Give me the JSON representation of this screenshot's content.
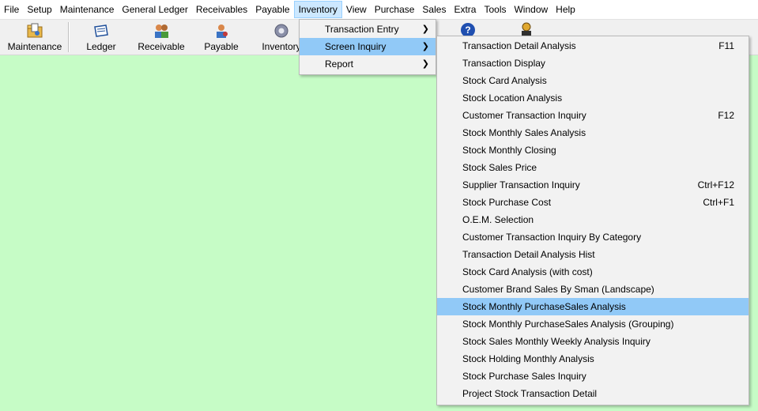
{
  "menubar": {
    "items": [
      "File",
      "Setup",
      "Maintenance",
      "General Ledger",
      "Receivables",
      "Payable",
      "Inventory",
      "View",
      "Purchase",
      "Sales",
      "Extra",
      "Tools",
      "Window",
      "Help"
    ],
    "active_index": 6
  },
  "toolbar": {
    "buttons": [
      {
        "label": "Maintenance",
        "icon": "folder-icon"
      },
      {
        "label": "Ledger",
        "icon": "ledger-icon"
      },
      {
        "label": "Receivable",
        "icon": "people-icon"
      },
      {
        "label": "Payable",
        "icon": "payable-icon"
      },
      {
        "label": "Inventory",
        "icon": "gear-icon"
      }
    ],
    "right_icons": [
      "help-icon",
      "user-icon"
    ]
  },
  "inventory_menu": {
    "items": [
      {
        "label": "Transaction Entry",
        "has_submenu": true
      },
      {
        "label": "Screen Inquiry",
        "has_submenu": true
      },
      {
        "label": "Report",
        "has_submenu": true
      }
    ],
    "open_index": 1
  },
  "screen_inquiry_menu": {
    "items": [
      {
        "label": "Transaction Detail Analysis",
        "shortcut": "F11"
      },
      {
        "label": "Transaction Display",
        "shortcut": ""
      },
      {
        "label": "Stock Card Analysis",
        "shortcut": ""
      },
      {
        "label": "Stock Location Analysis",
        "shortcut": ""
      },
      {
        "label": "Customer Transaction Inquiry",
        "shortcut": "F12"
      },
      {
        "label": "Stock Monthly Sales Analysis",
        "shortcut": ""
      },
      {
        "label": "Stock Monthly Closing",
        "shortcut": ""
      },
      {
        "label": "Stock Sales Price",
        "shortcut": ""
      },
      {
        "label": "Supplier Transaction Inquiry",
        "shortcut": "Ctrl+F12"
      },
      {
        "label": "Stock Purchase Cost",
        "shortcut": "Ctrl+F1"
      },
      {
        "label": "O.E.M. Selection",
        "shortcut": ""
      },
      {
        "label": "Customer Transaction Inquiry By Category",
        "shortcut": ""
      },
      {
        "label": "Transaction Detail Analysis Hist",
        "shortcut": ""
      },
      {
        "label": "Stock Card Analysis (with cost)",
        "shortcut": ""
      },
      {
        "label": "Customer Brand Sales By Sman (Landscape)",
        "shortcut": ""
      },
      {
        "label": "Stock Monthly PurchaseSales Analysis",
        "shortcut": ""
      },
      {
        "label": "Stock Monthly PurchaseSales Analysis (Grouping)",
        "shortcut": ""
      },
      {
        "label": "Stock Sales Monthly Weekly Analysis Inquiry",
        "shortcut": ""
      },
      {
        "label": "Stock Holding Monthly Analysis",
        "shortcut": ""
      },
      {
        "label": "Stock Purchase Sales Inquiry",
        "shortcut": ""
      },
      {
        "label": "Project Stock Transaction Detail",
        "shortcut": ""
      }
    ],
    "highlight_index": 15
  },
  "colors": {
    "workspace": "#c6fcc6",
    "highlight": "#91c9f7",
    "menu_bg": "#f2f2f2"
  }
}
